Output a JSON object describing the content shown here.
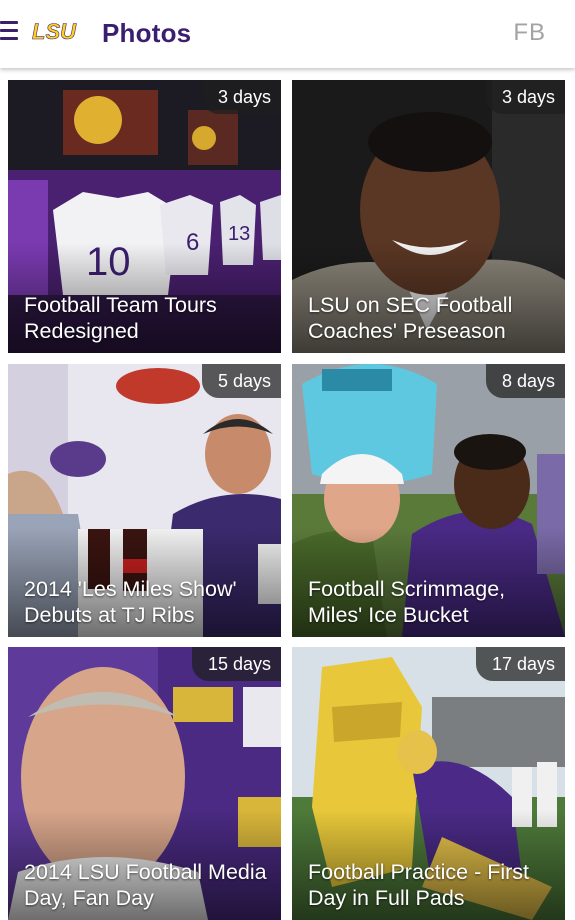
{
  "header": {
    "logo_text": "LSU",
    "title": "Photos",
    "fb_label": "FB"
  },
  "colors": {
    "brand_purple": "#3b1f6e",
    "brand_gold": "#fdd023",
    "badge_bg": "#1e1e1e"
  },
  "icons": {
    "menu": "hamburger-menu-icon",
    "logo": "lsu-logo"
  },
  "photos": [
    {
      "caption": "Football Team Tours Redesigned",
      "age": "3 days"
    },
    {
      "caption": "LSU on SEC Football Coaches' Preseason",
      "age": "3 days"
    },
    {
      "caption": "2014 'Les Miles Show' Debuts at TJ Ribs",
      "age": "5 days"
    },
    {
      "caption": "Football Scrimmage, Miles' Ice Bucket",
      "age": "8 days"
    },
    {
      "caption": "2014 LSU Football Media Day, Fan Day",
      "age": "15 days"
    },
    {
      "caption": "Football Practice - First Day in Full Pads",
      "age": "17 days"
    }
  ]
}
